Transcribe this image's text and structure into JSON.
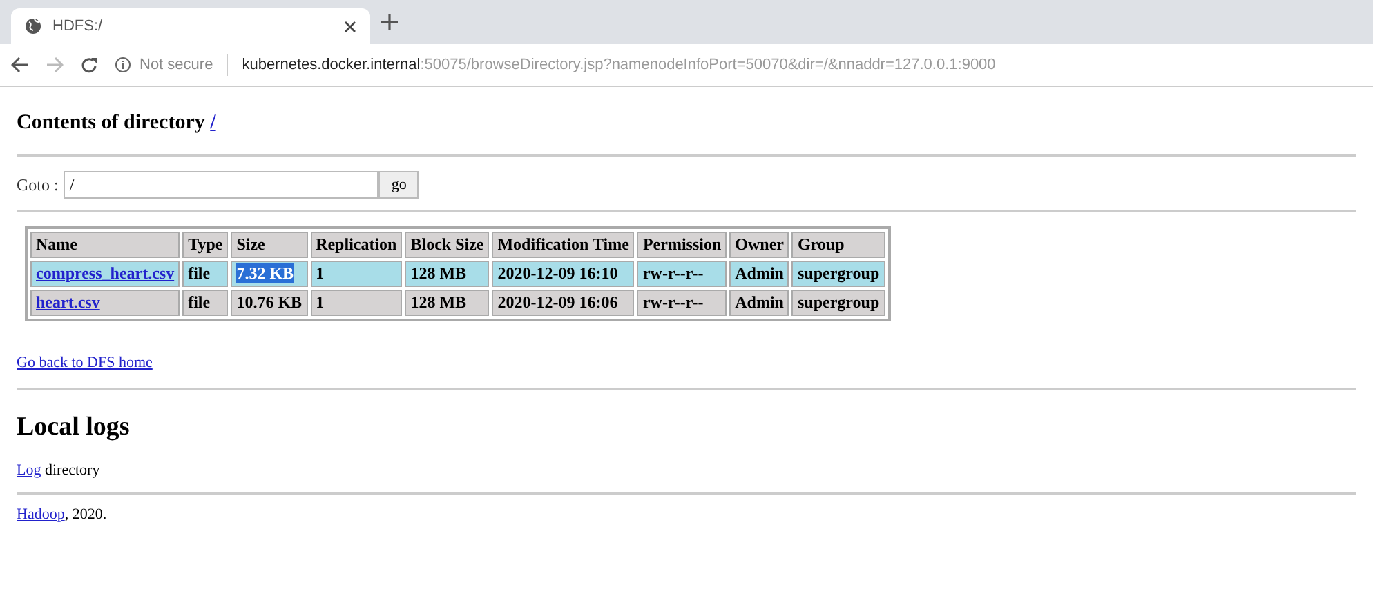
{
  "browser": {
    "tab_title": "HDFS:/",
    "url_security": "Not secure",
    "url_host": "kubernetes.docker.internal",
    "url_rest": ":50075/browseDirectory.jsp?namenodeInfoPort=50070&dir=/&nnaddr=127.0.0.1:9000"
  },
  "heading": {
    "text": "Contents of directory ",
    "link": "/"
  },
  "goto": {
    "label": "Goto :",
    "value": "/",
    "button": "go"
  },
  "table": {
    "columns": [
      "Name",
      "Type",
      "Size",
      "Replication",
      "Block Size",
      "Modification Time",
      "Permission",
      "Owner",
      "Group"
    ],
    "rows": [
      {
        "selected": true,
        "size_highlighted": true,
        "cells": [
          "compress_heart.csv",
          "file",
          "7.32 KB",
          "1",
          "128 MB",
          "2020-12-09 16:10",
          "rw-r--r--",
          "Admin",
          "supergroup"
        ]
      },
      {
        "selected": false,
        "size_highlighted": false,
        "cells": [
          "heart.csv",
          "file",
          "10.76 KB",
          "1",
          "128 MB",
          "2020-12-09 16:06",
          "rw-r--r--",
          "Admin",
          "supergroup"
        ]
      }
    ]
  },
  "back_link": "Go back to DFS home",
  "logs": {
    "title": "Local logs",
    "link": "Log",
    "text": " directory"
  },
  "footer": {
    "link": "Hadoop",
    "text": ", 2020."
  }
}
